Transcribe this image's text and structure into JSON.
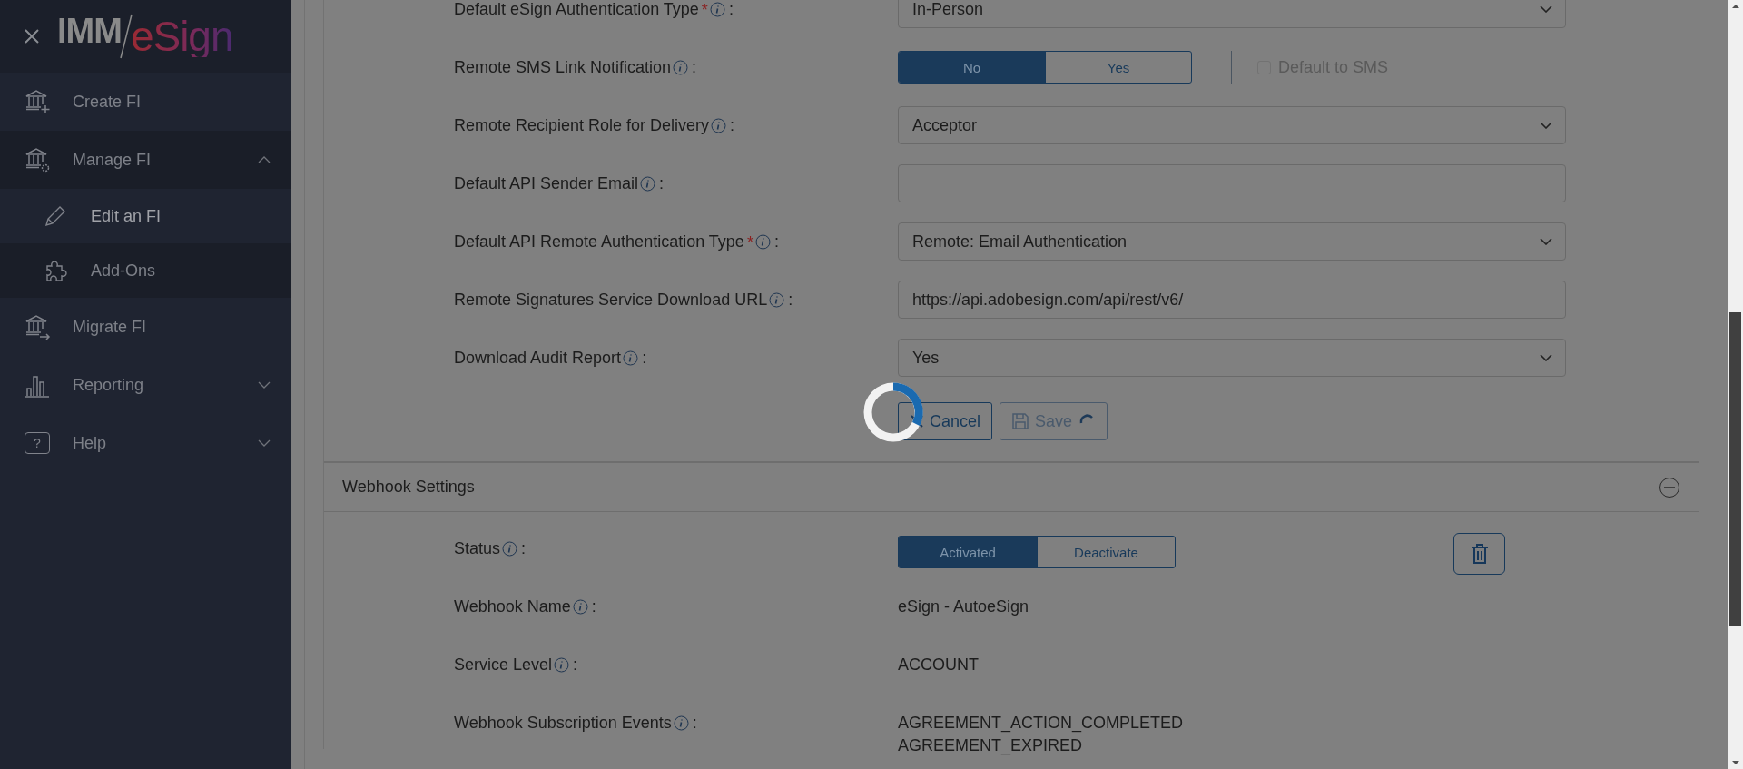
{
  "logo": {
    "prefix": "IMM",
    "name": "eSign"
  },
  "sidebar": {
    "items": [
      {
        "label": "Create FI"
      },
      {
        "label": "Manage FI",
        "expanded": true,
        "children": [
          {
            "label": "Edit an FI",
            "selected": true
          },
          {
            "label": "Add-Ons",
            "selected": false
          }
        ]
      },
      {
        "label": "Migrate FI"
      },
      {
        "label": "Reporting",
        "expanded": false
      },
      {
        "label": "Help",
        "expanded": false,
        "icon_text": "?"
      }
    ]
  },
  "form": {
    "rows": [
      {
        "label": "Default eSign Authentication Type",
        "marker": "*",
        "colon": ":",
        "kind": "select",
        "value": "In-Person"
      },
      {
        "label": "Remote SMS Link Notification",
        "colon": ":",
        "kind": "toggle",
        "options": [
          {
            "label": "No",
            "selected": true
          },
          {
            "label": "Yes",
            "selected": false
          }
        ],
        "checkbox": {
          "label": "Default to SMS",
          "checked": false,
          "disabled": true
        }
      },
      {
        "label": "Remote Recipient Role for Delivery",
        "colon": ":",
        "kind": "select",
        "value": "Acceptor"
      },
      {
        "label": "Default API Sender Email",
        "colon": ":",
        "kind": "text",
        "value": ""
      },
      {
        "label": "Default API Remote Authentication Type",
        "marker": "*",
        "colon": ":",
        "kind": "select",
        "value": "Remote: Email Authentication"
      },
      {
        "label": "Remote Signatures Service Download URL",
        "colon": ":",
        "kind": "text",
        "value": "https://api.adobesign.com/api/rest/v6/"
      },
      {
        "label": "Download Audit Report",
        "colon": ":",
        "kind": "select",
        "value": "Yes"
      }
    ],
    "buttons": [
      {
        "label": "Cancel",
        "kind": "cancel",
        "disabled": false,
        "busy": false
      },
      {
        "label": "Save",
        "kind": "save",
        "disabled": true,
        "busy": true
      }
    ]
  },
  "webhook": {
    "title": "Webhook Settings",
    "expanded": true,
    "rows": [
      {
        "label": "Status",
        "colon": ":",
        "kind": "toggle",
        "options": [
          {
            "label": "Activated",
            "selected": true
          },
          {
            "label": "Deactivate",
            "selected": false
          }
        ]
      },
      {
        "label": "Webhook Name",
        "colon": ":",
        "kind": "text",
        "values": [
          "eSign - AutoeSign"
        ]
      },
      {
        "label": "Service Level",
        "colon": ":",
        "kind": "text",
        "values": [
          "ACCOUNT"
        ]
      },
      {
        "label": "Webhook Subscription Events",
        "colon": ":",
        "kind": "text",
        "values": [
          "AGREEMENT_ACTION_COMPLETED",
          "AGREEMENT_EXPIRED"
        ]
      }
    ]
  },
  "loading": true
}
